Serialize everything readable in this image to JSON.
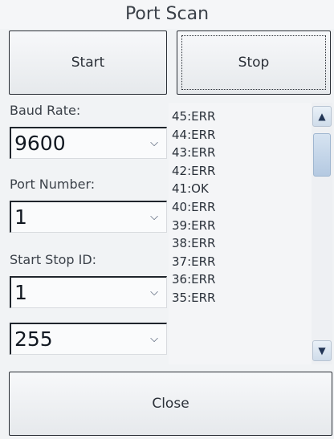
{
  "window": {
    "title": "Port Scan"
  },
  "buttons": {
    "start": "Start",
    "stop": "Stop",
    "close": "Close"
  },
  "baud": {
    "label": "Baud Rate:",
    "value": "9600"
  },
  "port": {
    "label": "Port Number:",
    "value": "1"
  },
  "ids": {
    "label": "Start Stop ID:",
    "start_value": "1",
    "stop_value": "255"
  },
  "results": {
    "items": [
      "45:ERR",
      "44:ERR",
      "43:ERR",
      "42:ERR",
      "41:OK",
      "40:ERR",
      "39:ERR",
      "38:ERR",
      "37:ERR",
      "36:ERR",
      "35:ERR"
    ],
    "scroll_position": 0.12
  },
  "icons": {
    "dropdown": "chevron-down-icon",
    "scroll_up": "chevron-up-icon",
    "scroll_down": "chevron-down-icon"
  },
  "colors": {
    "accent": "#233656",
    "border": "#2a2f36"
  }
}
